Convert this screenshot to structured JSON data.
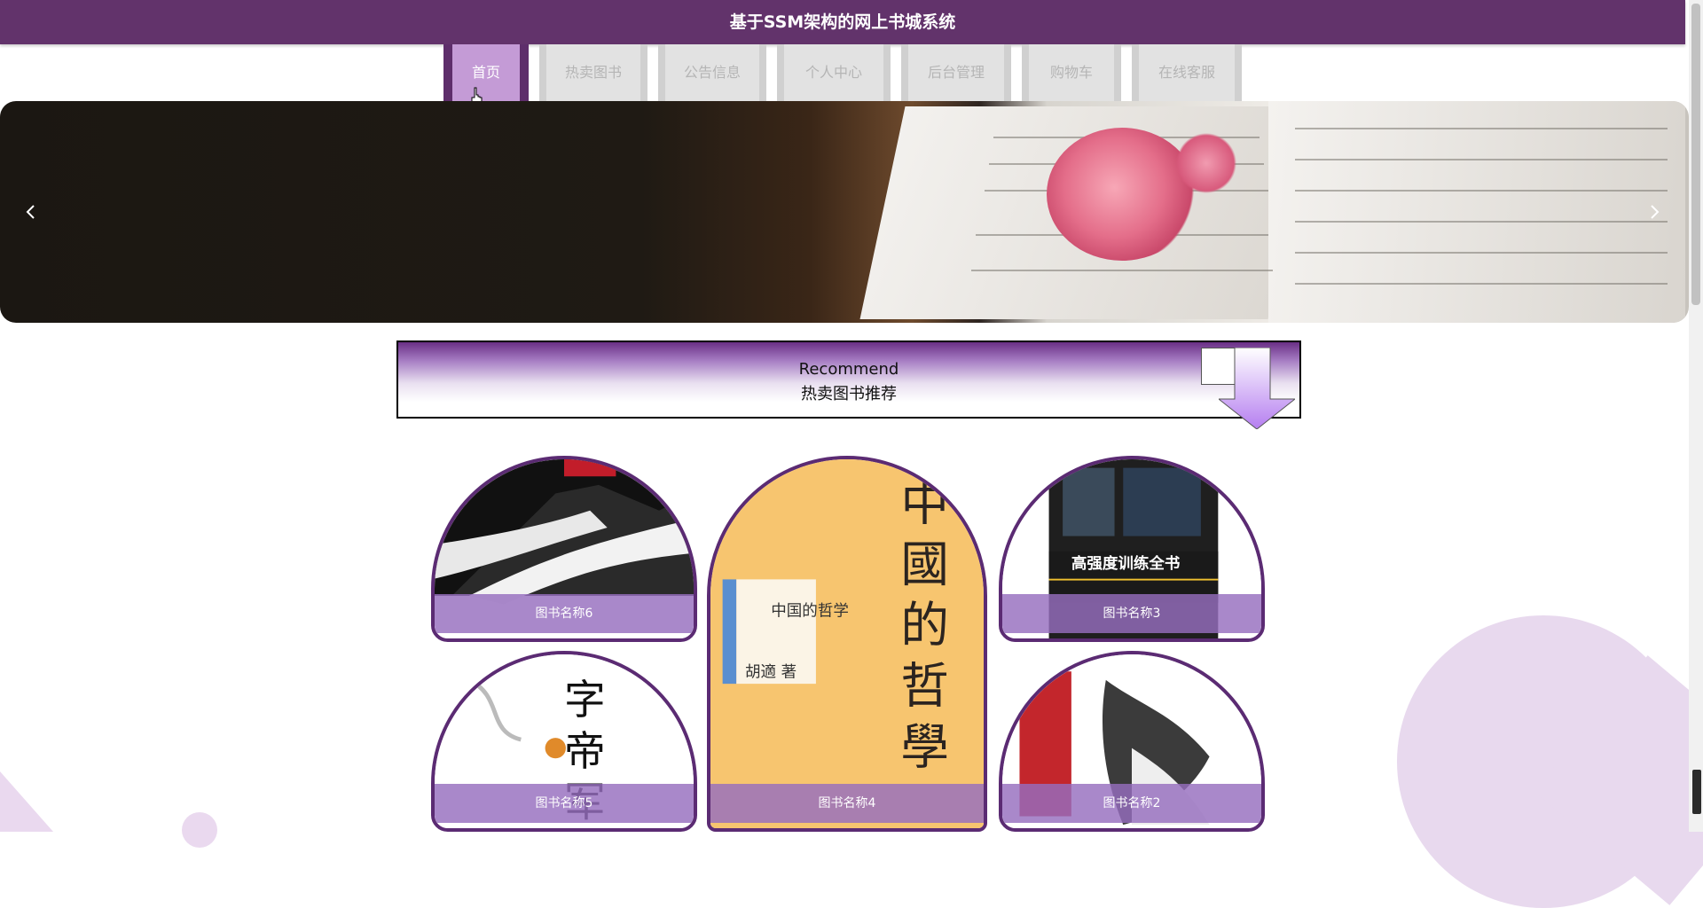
{
  "header": {
    "title": "基于SSM架构的网上书城系统"
  },
  "nav": {
    "items": [
      {
        "label": "首页",
        "active": true
      },
      {
        "label": "热卖图书",
        "active": false
      },
      {
        "label": "公告信息",
        "active": false
      },
      {
        "label": "个人中心",
        "active": false
      },
      {
        "label": "后台管理",
        "active": false
      },
      {
        "label": "购物车",
        "active": false
      },
      {
        "label": "在线客服",
        "active": false
      }
    ]
  },
  "banner": {
    "prev_icon": "chevron-left-icon",
    "next_icon": "chevron-right-icon"
  },
  "recommend": {
    "title_en": "Recommend",
    "title_cn": "热卖图书推荐"
  },
  "books": [
    {
      "name": "图书名称6"
    },
    {
      "name": "图书名称4"
    },
    {
      "name": "图书名称3"
    },
    {
      "name": "图书名称5"
    },
    {
      "name": "图书名称2"
    }
  ],
  "colors": {
    "header": "#62336b",
    "nav_active": "#c49bd6",
    "card_border": "#5b2b73"
  }
}
